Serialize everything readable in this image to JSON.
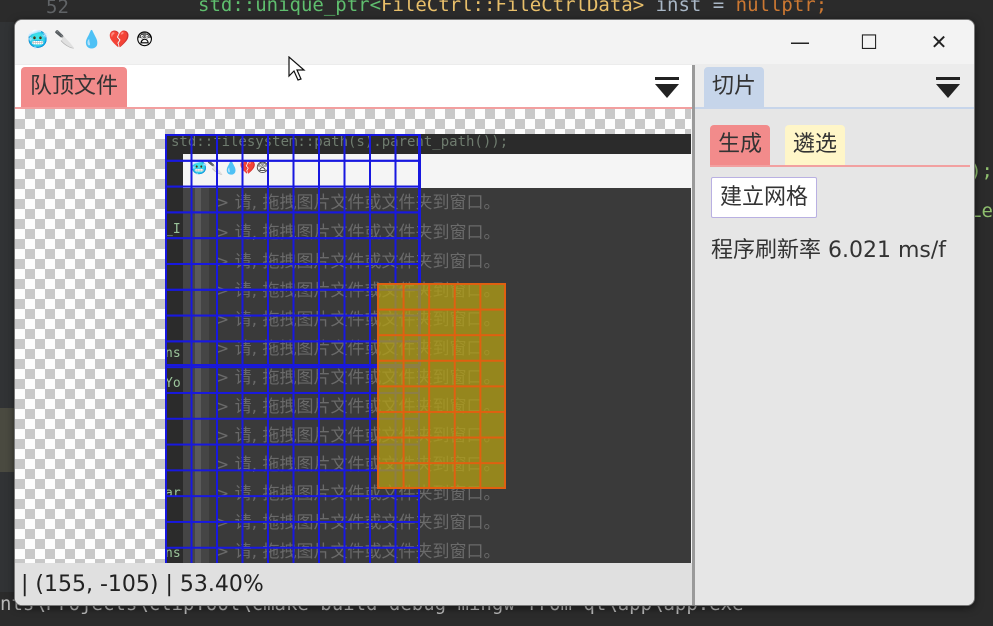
{
  "ide": {
    "line_number": "52",
    "code_line": {
      "ns": "std::",
      "fn": "unique_ptr<",
      "type": "FileCtrl::FileCtrlData>",
      "rest": "  inst = ",
      "kw": "nullptr;"
    },
    "side_text_1": ");",
    "side_text_2": "Le",
    "path": "nts\\Projects\\clipTool\\cmake-build-debug-mingw-from-qt\\app\\app.exe"
  },
  "window": {
    "title_icons": [
      "🥶",
      "🔪",
      "💧",
      "💔",
      "😨"
    ],
    "controls": {
      "minimize": "—",
      "maximize": "☐",
      "close": "✕"
    }
  },
  "left_panel": {
    "tab_label": "队顶文件",
    "status": "| (155, -105) | 53.40%",
    "preview": {
      "message": "> 请, 拖拽图片文件或文件夹到窗口。",
      "code_snippet": "std::filesystem::path(s).parent_path());",
      "side_labels": [
        "_I",
        "ns",
        "Yo",
        "ar",
        "ns"
      ]
    }
  },
  "right_panel": {
    "tab_label": "切片",
    "sub_tabs": [
      {
        "label": "生成",
        "active": true
      },
      {
        "label": "遴选",
        "active": false
      }
    ],
    "build_grid_button": "建立网格",
    "refresh_rate": "程序刷新率 6.021 ms/f"
  },
  "colors": {
    "tab_red": "#f28b8b",
    "tab_blue": "#c6d5ea",
    "tab_yellow": "#fff6c8",
    "grid_blue": "#1818e0",
    "grid_orange": "#e06010"
  }
}
